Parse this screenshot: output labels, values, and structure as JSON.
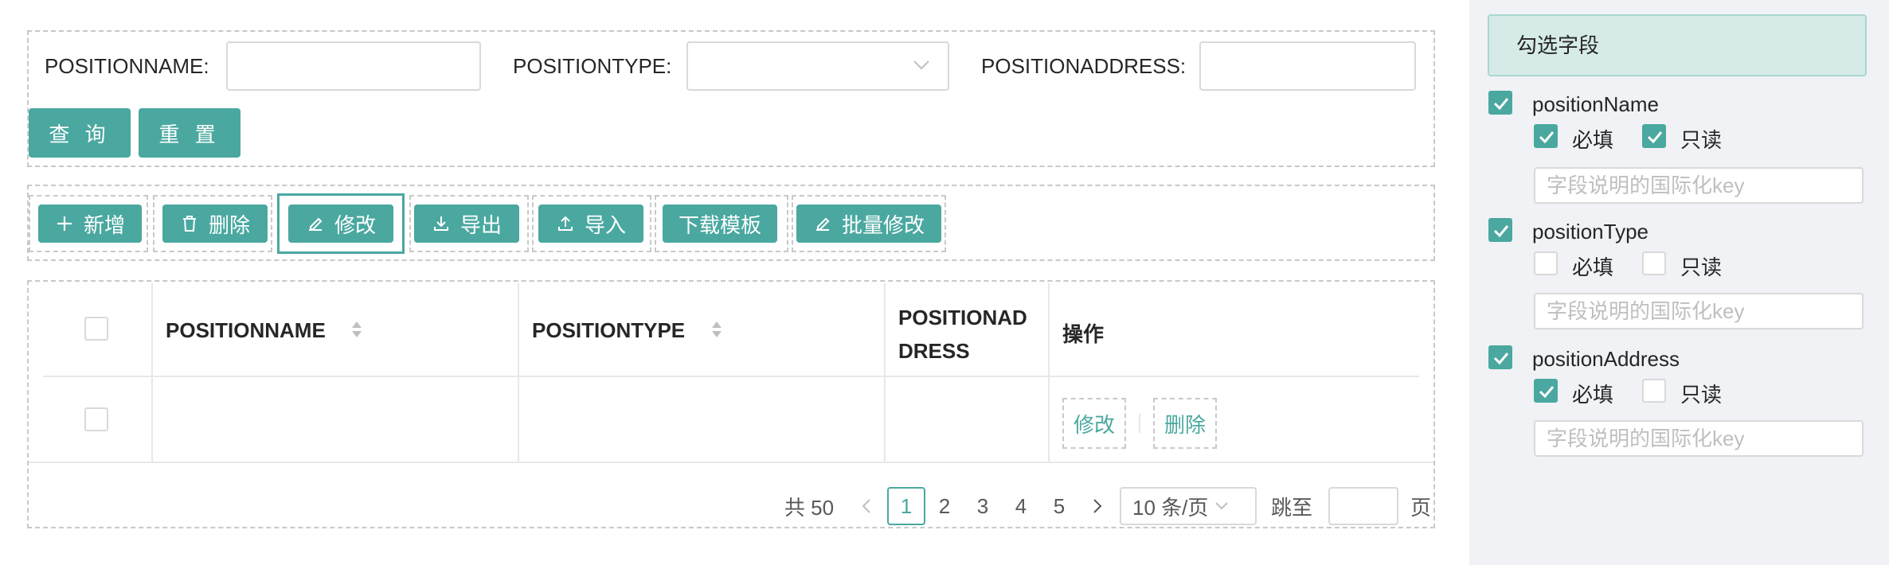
{
  "search": {
    "fields": [
      {
        "label": "POSITIONNAME:",
        "value": ""
      },
      {
        "label": "POSITIONTYPE:",
        "value": ""
      },
      {
        "label": "POSITIONADDRESS:",
        "value": ""
      }
    ],
    "query_label": "查 询",
    "reset_label": "重 置"
  },
  "toolbar": {
    "buttons": [
      {
        "label": "新增",
        "icon": "plus-icon"
      },
      {
        "label": "删除",
        "icon": "trash-icon"
      },
      {
        "label": "修改",
        "icon": "edit-icon",
        "selected": true
      },
      {
        "label": "导出",
        "icon": "download-icon"
      },
      {
        "label": "导入",
        "icon": "upload-icon"
      },
      {
        "label": "下载模板",
        "icon": ""
      },
      {
        "label": "批量修改",
        "icon": "edit-icon"
      }
    ]
  },
  "table": {
    "headers": [
      "POSITIONNAME",
      "POSITIONTYPE",
      "POSITIONAD DRESS",
      "操作"
    ],
    "header_positionaddress_line1": "POSITIONAD",
    "header_positionaddress_line2": "DRESS",
    "rows": [
      {
        "positionName": "",
        "positionType": "",
        "positionAddress": "",
        "actions": [
          "修改",
          "删除"
        ]
      }
    ]
  },
  "pagination": {
    "total_text": "共 50",
    "pages": [
      "1",
      "2",
      "3",
      "4",
      "5"
    ],
    "current": "1",
    "page_size": "10 条/页",
    "jump_label": "跳至",
    "page_suffix": "页",
    "jump_value": ""
  },
  "field_panel": {
    "title": "勾选字段",
    "required_label": "必填",
    "readonly_label": "只读",
    "key_placeholder": "字段说明的国际化key",
    "fields": [
      {
        "name": "positionName",
        "checked": true,
        "required": true,
        "readonly": true
      },
      {
        "name": "positionType",
        "checked": true,
        "required": false,
        "readonly": false
      },
      {
        "name": "positionAddress",
        "checked": true,
        "required": true,
        "readonly": false
      }
    ]
  },
  "colors": {
    "accent": "#4aa8a0",
    "panel_bg": "#f0f2f5",
    "panel_title_bg": "#d6ebe7"
  }
}
